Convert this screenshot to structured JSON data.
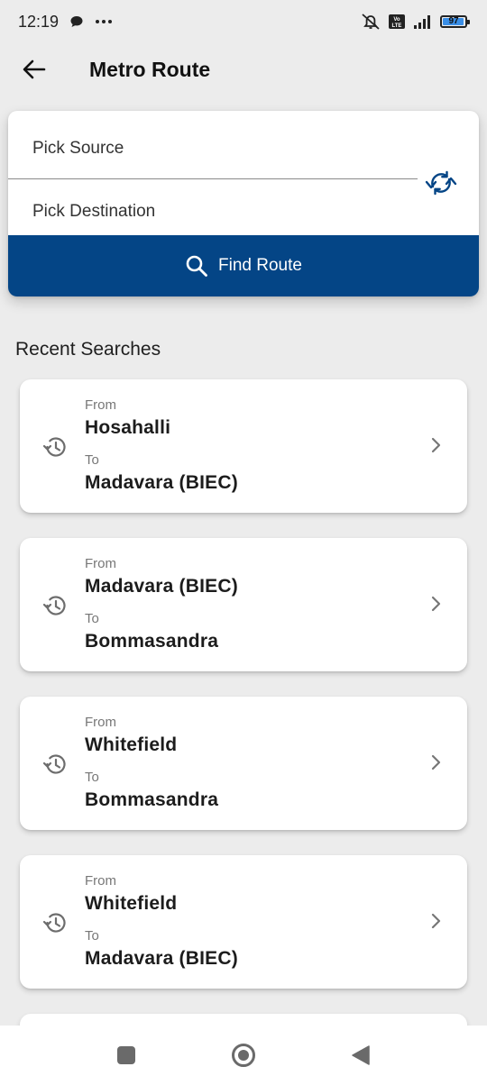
{
  "status_bar": {
    "time": "12:19",
    "battery_level": "97",
    "volte_label": "Vo LTE",
    "icons": [
      "chat-bubble-icon",
      "more-dots-icon",
      "alarm-off-icon",
      "volte-icon",
      "signal-icon",
      "battery-icon"
    ]
  },
  "app_bar": {
    "title": "Metro Route",
    "back_icon": "arrow-left-icon"
  },
  "search": {
    "source_placeholder": "Pick Source",
    "destination_placeholder": "Pick Destination",
    "swap_icon": "swap-arrows-icon",
    "find_button_label": "Find Route",
    "find_icon": "search-icon"
  },
  "recent": {
    "title": "Recent Searches",
    "from_label": "From",
    "to_label": "To",
    "items": [
      {
        "from": "Hosahalli",
        "to": "Madavara (BIEC)"
      },
      {
        "from": "Madavara (BIEC)",
        "to": "Bommasandra"
      },
      {
        "from": "Whitefield",
        "to": "Bommasandra"
      },
      {
        "from": "Whitefield",
        "to": "Madavara (BIEC)"
      }
    ]
  },
  "nav_bar": {
    "icons": [
      "recents-square-icon",
      "home-circle-icon",
      "back-triangle-icon"
    ]
  },
  "colors": {
    "primary": "#044586",
    "background": "#ececec",
    "card": "#ffffff"
  }
}
